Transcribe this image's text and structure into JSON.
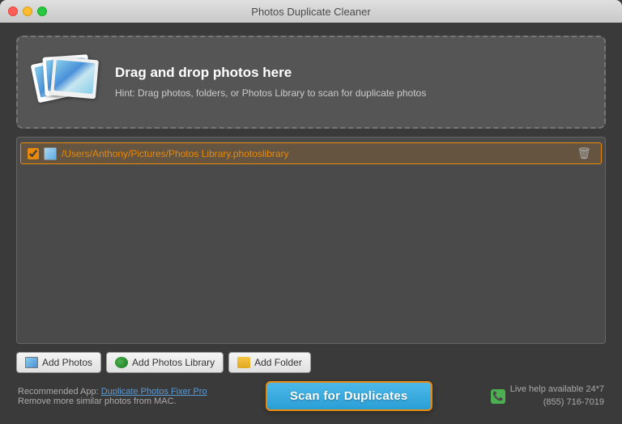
{
  "window": {
    "title": "Photos Duplicate Cleaner"
  },
  "titlebar": {
    "buttons": {
      "close": "close",
      "minimize": "minimize",
      "maximize": "maximize"
    }
  },
  "dropzone": {
    "heading": "Drag and drop photos here",
    "hint": "Hint: Drag photos, folders, or Photos Library to scan for duplicate photos"
  },
  "file_list": [
    {
      "checked": true,
      "path": "/Users/Anthony/Pictures/Photos Library.photoslibrary",
      "type": "photoslibrary"
    }
  ],
  "toolbar": {
    "add_photos_label": "Add Photos",
    "add_library_label": "Add Photos Library",
    "add_folder_label": "Add Folder"
  },
  "footer": {
    "recommended_prefix": "Recommended App: ",
    "recommended_app": "Duplicate Photos Fixer Pro",
    "recommended_suffix": "",
    "remove_text": "Remove more similar photos from MAC.",
    "scan_button": "Scan for Duplicates",
    "live_help": "Live help available 24*7",
    "phone": "(855) 716-7019"
  }
}
